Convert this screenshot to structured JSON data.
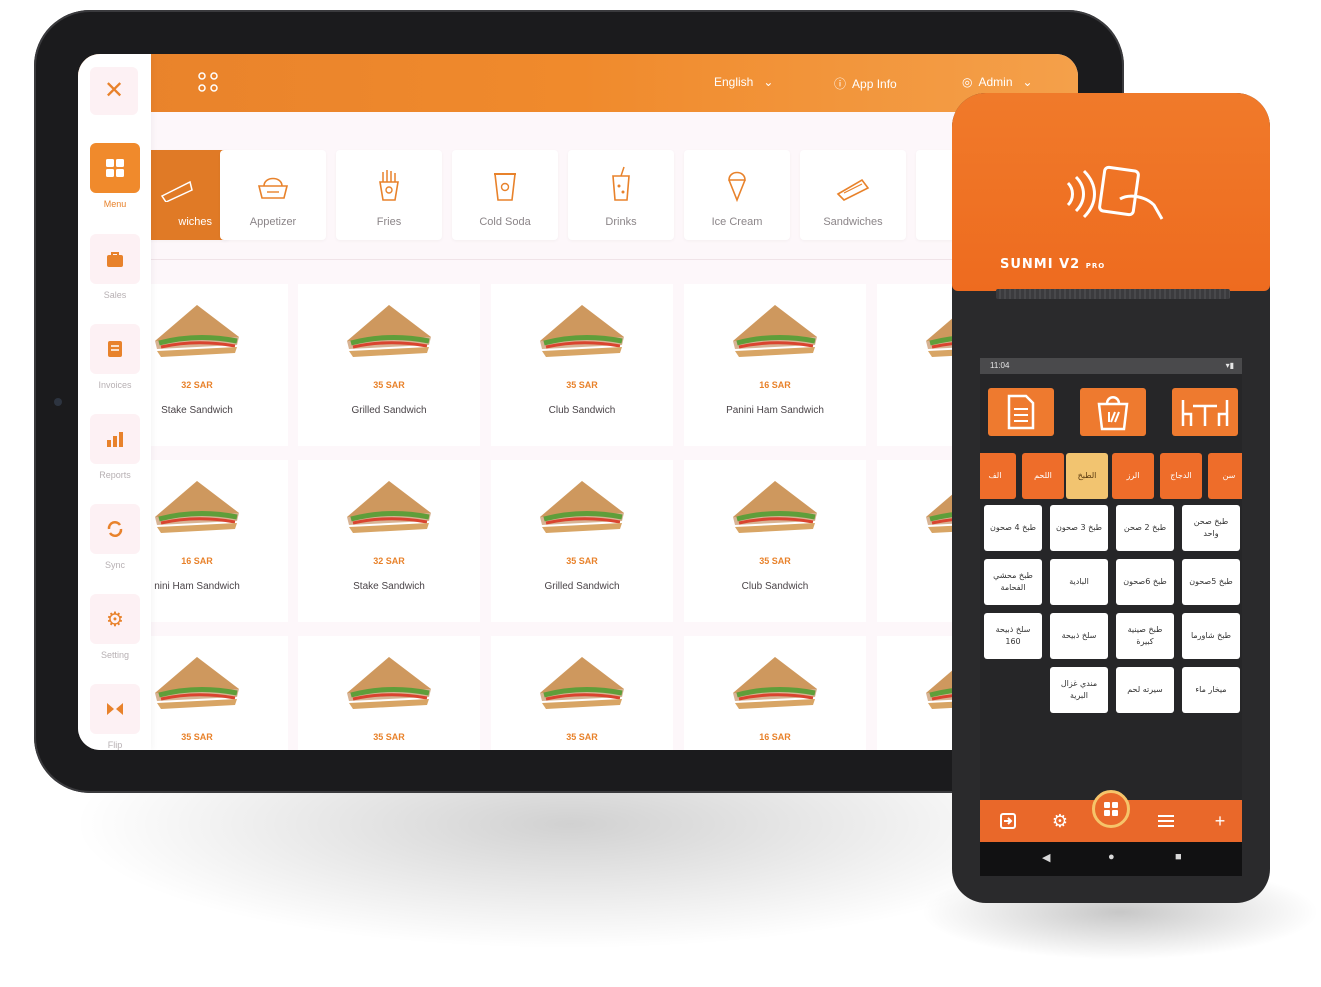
{
  "tablet": {
    "topbar": {
      "language": "English",
      "app_info": "App Info",
      "user": "Admin"
    },
    "sidebar": {
      "close_glyph": "✕",
      "items": [
        {
          "label": "Menu",
          "icon": "grid-icon",
          "active": true
        },
        {
          "label": "Sales",
          "icon": "bag-icon"
        },
        {
          "label": "Invoices",
          "icon": "invoice-icon"
        },
        {
          "label": "Reports",
          "icon": "bar-chart-icon"
        },
        {
          "label": "Sync",
          "icon": "sync-icon"
        },
        {
          "label": "Setting",
          "icon": "gear-icon"
        },
        {
          "label": "Flip",
          "icon": "flip-icon"
        }
      ]
    },
    "categories": [
      {
        "label": "wiches",
        "active": true
      },
      {
        "label": "Appetizer"
      },
      {
        "label": "Fries"
      },
      {
        "label": "Cold Soda"
      },
      {
        "label": "Drinks"
      },
      {
        "label": "Ice Cream"
      },
      {
        "label": "Sandwiches"
      }
    ],
    "products": [
      {
        "price": "32 SAR",
        "name": "Stake Sandwich"
      },
      {
        "price": "35 SAR",
        "name": "Grilled Sandwich"
      },
      {
        "price": "35 SAR",
        "name": "Club Sandwich"
      },
      {
        "price": "16 SAR",
        "name": "Panini Ham Sandwich"
      },
      {
        "price": "",
        "name": "Grille"
      },
      {
        "price": "16 SAR",
        "name": "nini Ham Sandwich"
      },
      {
        "price": "32 SAR",
        "name": "Stake Sandwich"
      },
      {
        "price": "35 SAR",
        "name": "Grilled Sandwich"
      },
      {
        "price": "35 SAR",
        "name": "Club Sandwich"
      },
      {
        "price": "",
        "name": "Grilled"
      },
      {
        "price": "35 SAR",
        "name": ""
      },
      {
        "price": "35 SAR",
        "name": ""
      },
      {
        "price": "35 SAR",
        "name": ""
      },
      {
        "price": "16 SAR",
        "name": ""
      },
      {
        "price": "",
        "name": ""
      }
    ]
  },
  "pos": {
    "brand": "SUNMI V2",
    "brand_suffix": "PRO",
    "status_time": "11:04",
    "func_buttons": [
      "invoice-icon",
      "bag-icon",
      "table-icon"
    ],
    "tabs": [
      {
        "label": "الف"
      },
      {
        "label": "اللحم"
      },
      {
        "label": "الطبخ",
        "active": true
      },
      {
        "label": "الرز"
      },
      {
        "label": "الدجاج"
      },
      {
        "label": "سن"
      }
    ],
    "menu_items": [
      "طبخ 4 صحون",
      "طبخ 3 صحون",
      "طبخ 2 صحن",
      "طبخ صحن واحد",
      "طبخ محشي الفحامة",
      "البادية",
      "طبخ 6صحون",
      "طبخ 5صحون",
      "سلخ ذبيحة 160",
      "سلخ ذبيحة",
      "طبخ صينية كبيرة",
      "طبخ شاورما",
      "",
      "مندي غزال البرية",
      "سيرته لحم",
      "ميخار ماء"
    ],
    "nav": [
      "login-icon",
      "gear-icon",
      "grid-icon",
      "list-icon",
      "+"
    ],
    "sys_nav": [
      "◀",
      "●",
      "■"
    ]
  }
}
